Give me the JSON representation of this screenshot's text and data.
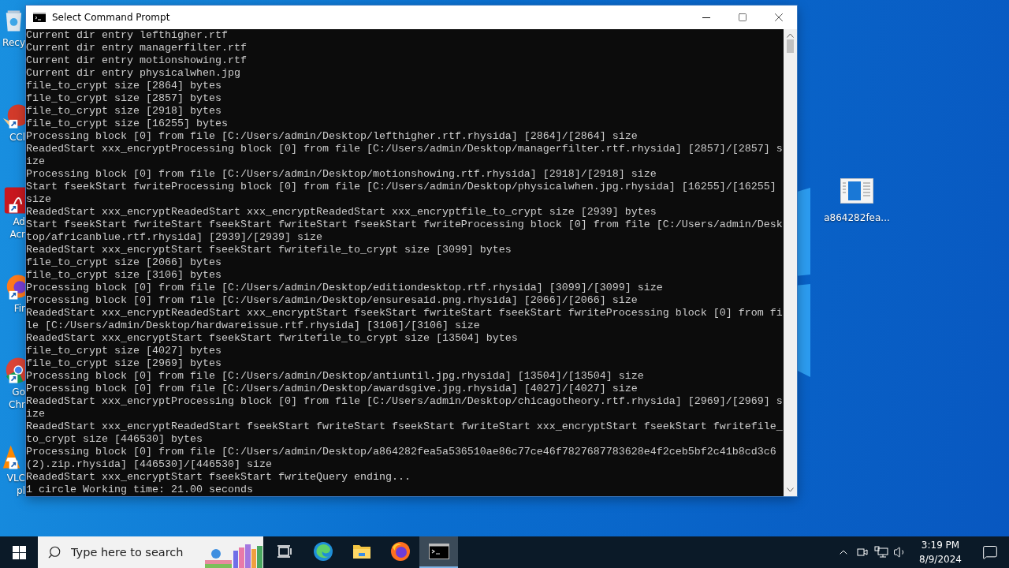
{
  "desktop_icons": [
    {
      "kind": "recycle",
      "label": [
        "Recy"
      ]
    },
    {
      "kind": "ccleaner",
      "label": [
        "CCl"
      ]
    },
    {
      "kind": "acrobat",
      "label": [
        "Ad",
        "Acr"
      ]
    },
    {
      "kind": "firefox",
      "label": [
        "Fir"
      ]
    },
    {
      "kind": "chrome",
      "label": [
        "Go",
        "Chr"
      ]
    },
    {
      "kind": "vlc",
      "label": [
        "VLC",
        "pl"
      ]
    }
  ],
  "desktop_file": {
    "label": "a864282fea..."
  },
  "window": {
    "title": "Select Command Prompt",
    "lines": [
      "Current dir entry lefthigher.rtf",
      "Current dir entry managerfilter.rtf",
      "Current dir entry motionshowing.rtf",
      "Current dir entry physicalwhen.jpg",
      "file_to_crypt size [2864] bytes",
      "file_to_crypt size [2857] bytes",
      "file_to_crypt size [2918] bytes",
      "file_to_crypt size [16255] bytes",
      "Processing block [0] from file [C:/Users/admin/Desktop/lefthigher.rtf.rhysida] [2864]/[2864] size",
      "ReadedStart xxx_encryptProcessing block [0] from file [C:/Users/admin/Desktop/managerfilter.rtf.rhysida] [2857]/[2857] s",
      "ize",
      "Processing block [0] from file [C:/Users/admin/Desktop/motionshowing.rtf.rhysida] [2918]/[2918] size",
      "Start fseekStart fwriteProcessing block [0] from file [C:/Users/admin/Desktop/physicalwhen.jpg.rhysida] [16255]/[16255]",
      "size",
      "ReadedStart xxx_encryptReadedStart xxx_encryptReadedStart xxx_encryptfile_to_crypt size [2939] bytes",
      "Start fseekStart fwriteStart fseekStart fwriteStart fseekStart fwriteProcessing block [0] from file [C:/Users/admin/Desk",
      "top/africanblue.rtf.rhysida] [2939]/[2939] size",
      "ReadedStart xxx_encryptStart fseekStart fwritefile_to_crypt size [3099] bytes",
      "file_to_crypt size [2066] bytes",
      "file_to_crypt size [3106] bytes",
      "Processing block [0] from file [C:/Users/admin/Desktop/editiondesktop.rtf.rhysida] [3099]/[3099] size",
      "Processing block [0] from file [C:/Users/admin/Desktop/ensuresaid.png.rhysida] [2066]/[2066] size",
      "ReadedStart xxx_encryptReadedStart xxx_encryptStart fseekStart fwriteStart fseekStart fwriteProcessing block [0] from fi",
      "le [C:/Users/admin/Desktop/hardwareissue.rtf.rhysida] [3106]/[3106] size",
      "ReadedStart xxx_encryptStart fseekStart fwritefile_to_crypt size [13504] bytes",
      "file_to_crypt size [4027] bytes",
      "file_to_crypt size [2969] bytes",
      "Processing block [0] from file [C:/Users/admin/Desktop/antiuntil.jpg.rhysida] [13504]/[13504] size",
      "Processing block [0] from file [C:/Users/admin/Desktop/awardsgive.jpg.rhysida] [4027]/[4027] size",
      "ReadedStart xxx_encryptProcessing block [0] from file [C:/Users/admin/Desktop/chicagotheory.rtf.rhysida] [2969]/[2969] s",
      "ize",
      "ReadedStart xxx_encryptReadedStart fseekStart fwriteStart fseekStart fwriteStart xxx_encryptStart fseekStart fwritefile_",
      "to_crypt size [446530] bytes",
      "Processing block [0] from file [C:/Users/admin/Desktop/a864282fea5a536510ae86c77ce46f7827687783628e4f2ceb5bf2c41b8cd3c6",
      "(2).zip.rhysida] [446530]/[446530] size",
      "ReadedStart xxx_encryptStart fseekStart fwriteQuery ending...",
      "1 circle Working time: 21.00 seconds"
    ]
  },
  "taskbar": {
    "search": {
      "placeholder": "Type here to search"
    },
    "apps": [
      {
        "kind": "taskview",
        "selected": false
      },
      {
        "kind": "edge",
        "selected": false
      },
      {
        "kind": "explorer",
        "selected": false
      },
      {
        "kind": "firefox",
        "selected": false
      },
      {
        "kind": "cmd",
        "selected": true
      }
    ],
    "clock": {
      "time": "3:19 PM",
      "date": "8/9/2024"
    }
  }
}
